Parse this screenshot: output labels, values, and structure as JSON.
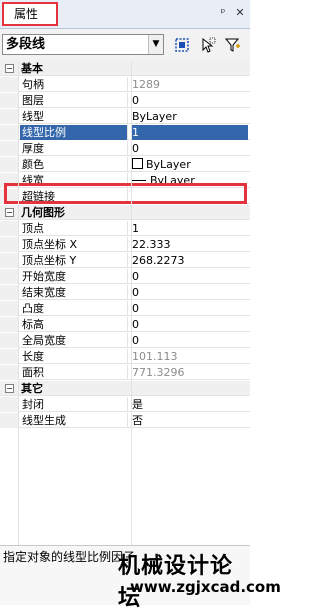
{
  "panel": {
    "tab_title": "属性",
    "pin_glyph": "ᵖ",
    "pin_icon": "pin-icon",
    "close_glyph": "✕",
    "close_icon": "close-icon"
  },
  "selection": {
    "object_type": "多段线"
  },
  "toolbar": {
    "tools": [
      "quick-select-icon",
      "select-objects-icon",
      "toggle-pickadd-icon"
    ]
  },
  "categories": [
    {
      "label": "基本",
      "expander": "⊟"
    },
    {
      "label": "几何图形",
      "expander": "⊟"
    },
    {
      "label": "其它",
      "expander": "⊟"
    }
  ],
  "properties": {
    "basic": [
      {
        "name": "句柄",
        "value": "1289",
        "readonly": true
      },
      {
        "name": "图层",
        "value": "0"
      },
      {
        "name": "线型",
        "value": "ByLayer"
      },
      {
        "name": "线型比例",
        "value": "1",
        "selected": true
      },
      {
        "name": "厚度",
        "value": "0"
      },
      {
        "name": "颜色",
        "value": "ByLayer",
        "swatch": "#ffffff"
      },
      {
        "name": "线宽",
        "value": "ByLayer",
        "line": true
      },
      {
        "name": "超链接",
        "value": ""
      }
    ],
    "geometry": [
      {
        "name": "顶点",
        "value": "1"
      },
      {
        "name": "顶点坐标 X",
        "value": "22.333"
      },
      {
        "name": "顶点坐标 Y",
        "value": "268.2273"
      },
      {
        "name": "开始宽度",
        "value": "0"
      },
      {
        "name": "结束宽度",
        "value": "0"
      },
      {
        "name": "凸度",
        "value": "0"
      },
      {
        "name": "标高",
        "value": "0"
      },
      {
        "name": "全局宽度",
        "value": "0"
      },
      {
        "name": "长度",
        "value": "101.113",
        "readonly": true
      },
      {
        "name": "面积",
        "value": "771.3296",
        "readonly": true
      }
    ],
    "misc": [
      {
        "name": "封闭",
        "value": "是"
      },
      {
        "name": "线型生成",
        "value": "否"
      }
    ]
  },
  "description": "指定对象的线型比例因子",
  "watermark": {
    "title": "机械设计论坛",
    "url": "www.zgjxcad.com"
  },
  "colors": {
    "highlight": "#e4333c",
    "selection": "#3366aa"
  }
}
